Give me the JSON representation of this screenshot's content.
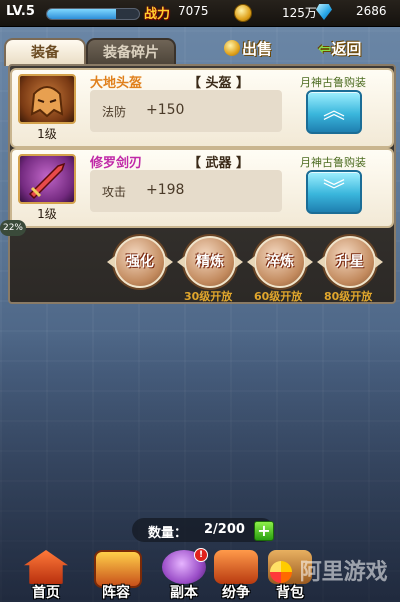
{
  "topbar": {
    "level": "LV.5",
    "exp_progress": 0.75,
    "power_label": "战力",
    "power_value": "7075",
    "coin_value": "125万",
    "gem_value": "2686"
  },
  "tabs": {
    "equip": "装备",
    "fragments": "装备碎片"
  },
  "actions": {
    "sell": "出售",
    "back": "返回"
  },
  "items": [
    {
      "name": "大地头盔",
      "slot": "【 头盔 】",
      "source": "月神古鲁购装",
      "level": "1级",
      "stat_name": "法防",
      "stat_value": "+150",
      "button_icon": "chevron-up-icon"
    },
    {
      "name": "修罗剑刃",
      "slot": "【 武器 】",
      "source": "月神古鲁购装",
      "level": "1级",
      "stat_name": "攻击",
      "stat_value": "+198",
      "button_icon": "chevron-down-icon"
    }
  ],
  "upgrades": [
    {
      "label": "强化",
      "unlock": ""
    },
    {
      "label": "精炼",
      "unlock": "30级开放"
    },
    {
      "label": "淬炼",
      "unlock": "60级开放"
    },
    {
      "label": "升星",
      "unlock": "80级开放"
    }
  ],
  "side_percent": "22%",
  "inventory": {
    "count_label": "数量：",
    "count_value": "2/200"
  },
  "nav": [
    {
      "label": "首页",
      "icon": "home-icon"
    },
    {
      "label": "阵容",
      "icon": "team-icon"
    },
    {
      "label": "副本",
      "icon": "dungeon-icon"
    },
    {
      "label": "纷争",
      "icon": "battle-icon"
    },
    {
      "label": "背包",
      "icon": "bag-icon"
    }
  ],
  "watermark": "阿里游戏",
  "colors": {
    "power": "#ffcf2e",
    "orange_name": "#e0801c",
    "purple_name": "#c02aa8",
    "button_blue": "#3ab6dc",
    "unlock_text": "#e0a62c"
  }
}
